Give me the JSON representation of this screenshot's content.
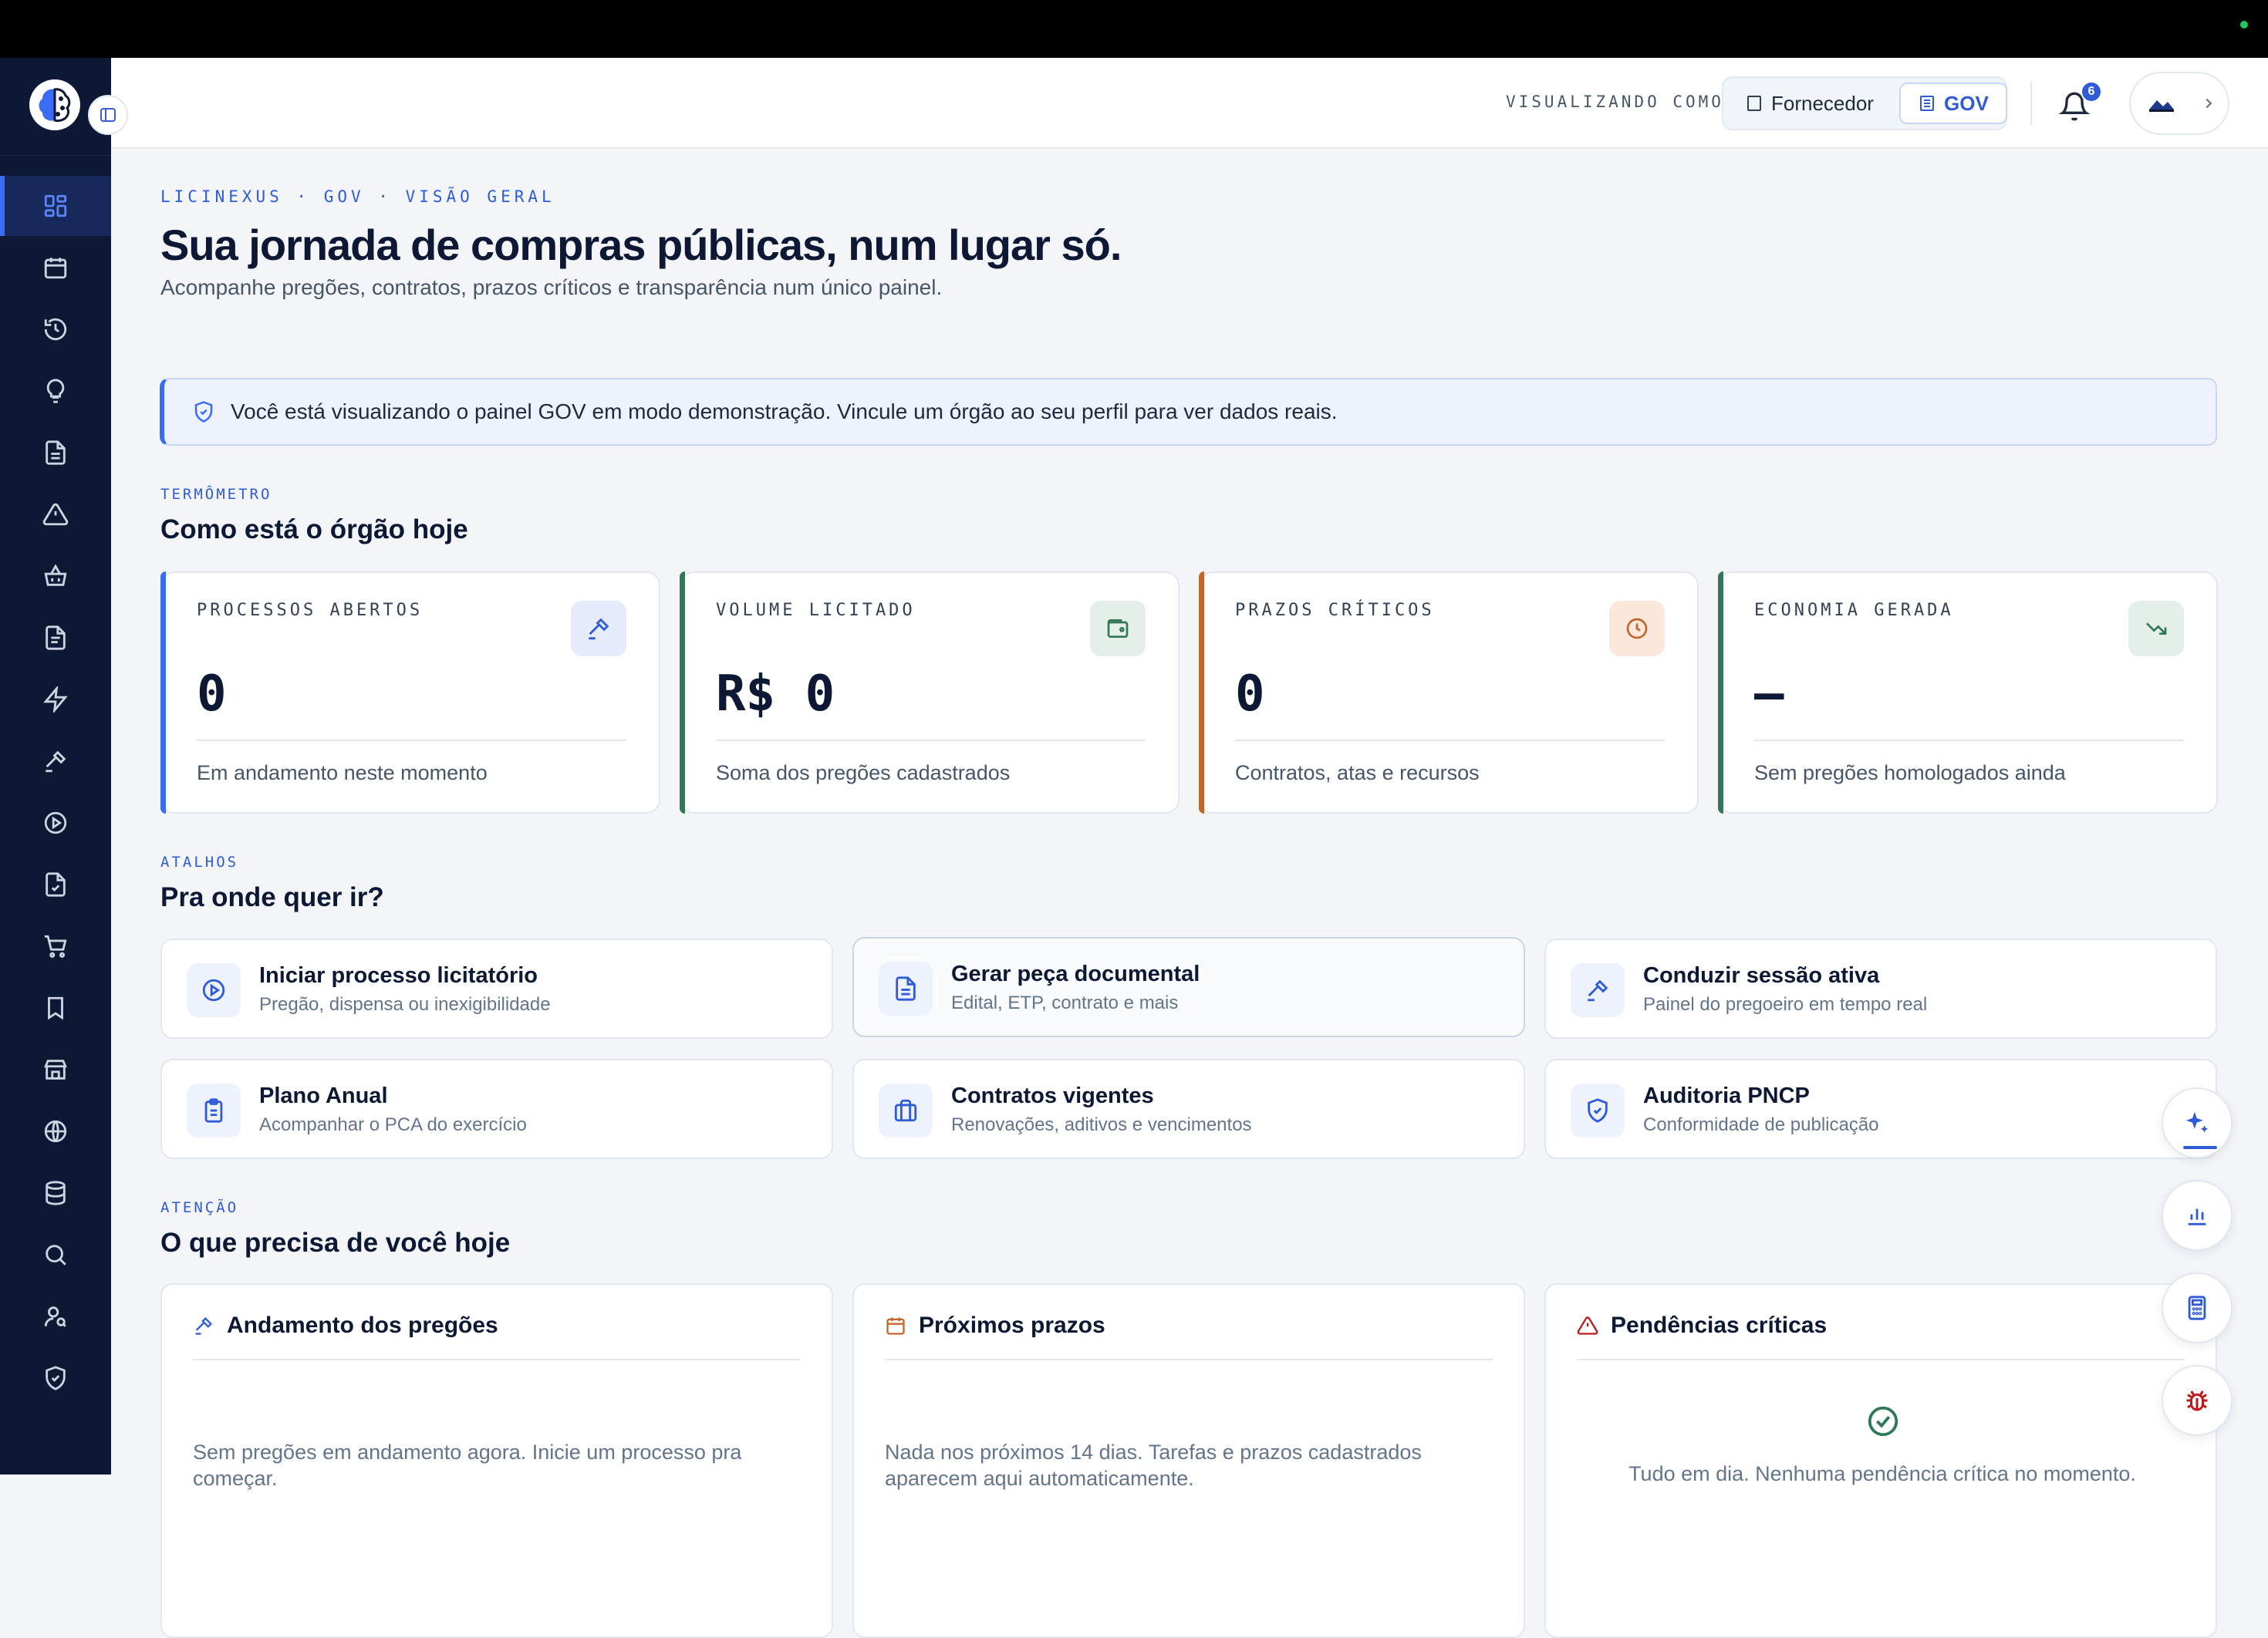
{
  "header": {
    "viewing_as_label": "VISUALIZANDO COMO:",
    "role_fornecedor": "Fornecedor",
    "role_gov": "GOV",
    "notification_count": "6"
  },
  "page": {
    "breadcrumb": "LICINEXUS · GOV · VISÃO GERAL",
    "title": "Sua jornada de compras públicas, num lugar só.",
    "subtitle": "Acompanhe pregões, contratos, prazos críticos e transparência num único painel.",
    "notice": "Você está visualizando o painel GOV em modo demonstração. Vincule um órgão ao seu perfil para ver dados reais."
  },
  "thermometer": {
    "eyebrow": "TERMÔMETRO",
    "title": "Como está o órgão hoje",
    "cards": [
      {
        "label": "PROCESSOS ABERTOS",
        "value": "0",
        "desc": "Em andamento neste momento",
        "accent": "#3b6cf6",
        "icon": "gavel-icon"
      },
      {
        "label": "VOLUME LICITADO",
        "value": "R$ 0",
        "desc": "Soma dos pregões cadastrados",
        "accent": "#2f7a55",
        "icon": "wallet-icon"
      },
      {
        "label": "PRAZOS CRÍTICOS",
        "value": "0",
        "desc": "Contratos, atas e recursos",
        "accent": "#c2662d",
        "icon": "clock-icon"
      },
      {
        "label": "ECONOMIA GERADA",
        "value": "—",
        "desc": "Sem pregões homologados ainda",
        "accent": "#2f7a55",
        "icon": "trending-down-icon"
      }
    ]
  },
  "shortcuts": {
    "eyebrow": "ATALHOS",
    "title": "Pra onde quer ir?",
    "items": [
      {
        "title": "Iniciar processo licitatório",
        "desc": "Pregão, dispensa ou inexigibilidade"
      },
      {
        "title": "Gerar peça documental",
        "desc": "Edital, ETP, contrato e mais"
      },
      {
        "title": "Conduzir sessão ativa",
        "desc": "Painel do pregoeiro em tempo real"
      },
      {
        "title": "Plano Anual",
        "desc": "Acompanhar o PCA do exercício"
      },
      {
        "title": "Contratos vigentes",
        "desc": "Renovações, aditivos e vencimentos"
      },
      {
        "title": "Auditoria PNCP",
        "desc": "Conformidade de publicação"
      }
    ]
  },
  "attention": {
    "eyebrow": "ATENÇÃO",
    "title": "O que precisa de você hoje",
    "panels": [
      {
        "title": "Andamento dos pregões",
        "text": "Sem pregões em andamento agora. Inicie um processo pra começar."
      },
      {
        "title": "Próximos prazos",
        "text": "Nada nos próximos 14 dias. Tarefas e prazos cadastrados aparecem aqui automaticamente."
      },
      {
        "title": "Pendências críticas",
        "text": "Tudo em dia. Nenhuma pendência crítica no momento."
      }
    ]
  }
}
